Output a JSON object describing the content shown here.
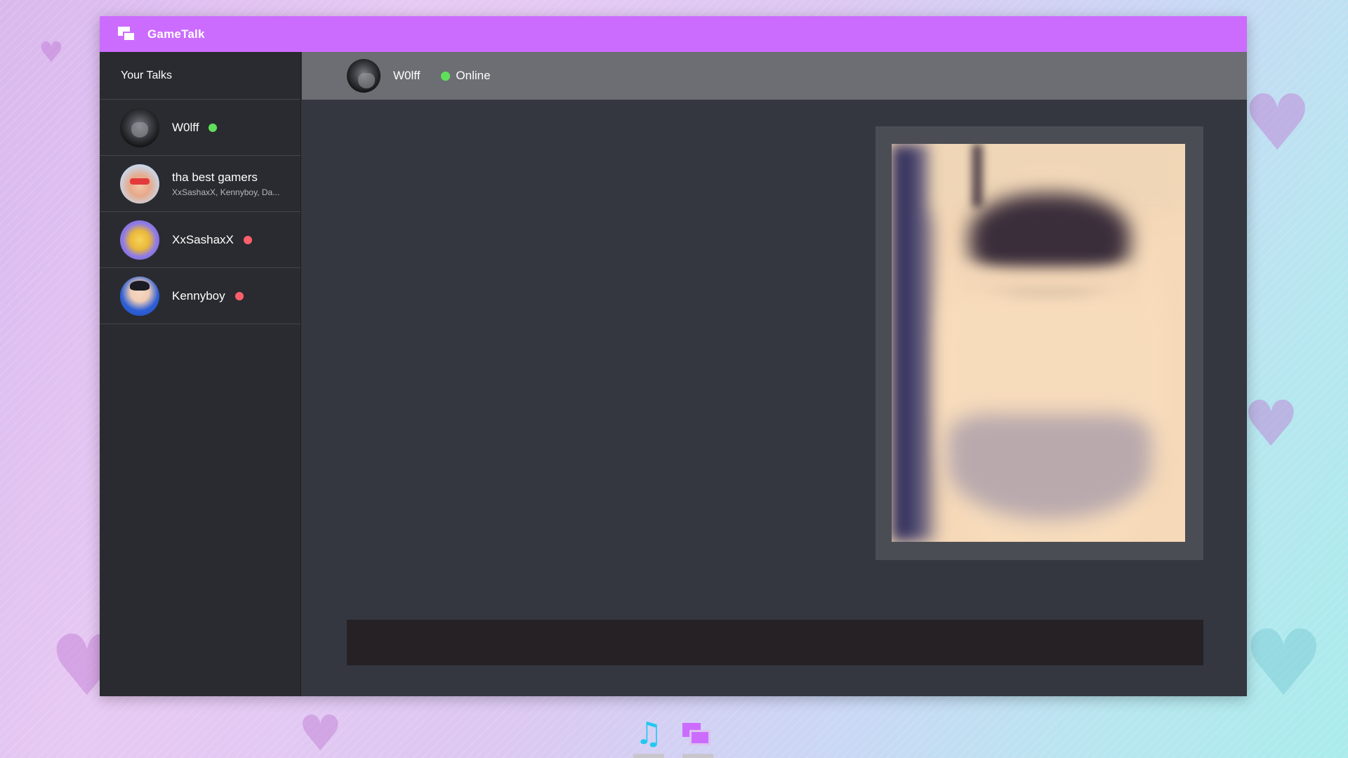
{
  "app": {
    "title": "GameTalk",
    "accent_color": "#cc6cff"
  },
  "sidebar": {
    "header": "Your Talks",
    "items": [
      {
        "name": "W0lff",
        "subtitle": "",
        "status": "online",
        "avatar": "wolf-avatar"
      },
      {
        "name": "tha best gamers",
        "subtitle": "XxSashaxX, Kennyboy, Da...",
        "status": "",
        "avatar": "group-avatar"
      },
      {
        "name": "XxSashaxX",
        "subtitle": "",
        "status": "offline",
        "avatar": "sasha-avatar"
      },
      {
        "name": "Kennyboy",
        "subtitle": "",
        "status": "offline",
        "avatar": "kenny-avatar"
      }
    ]
  },
  "chat": {
    "contact_name": "W0lff",
    "status_text": "Online",
    "status_color": "#5fe05b",
    "message": {
      "type": "image",
      "content": "blurred-image"
    },
    "composer": {
      "value": "",
      "placeholder": ""
    }
  },
  "dock": {
    "items": [
      {
        "icon": "music-note-icon",
        "color": "#22c8f0"
      },
      {
        "icon": "chat-bubbles-icon",
        "color": "#cc6cff"
      }
    ]
  }
}
